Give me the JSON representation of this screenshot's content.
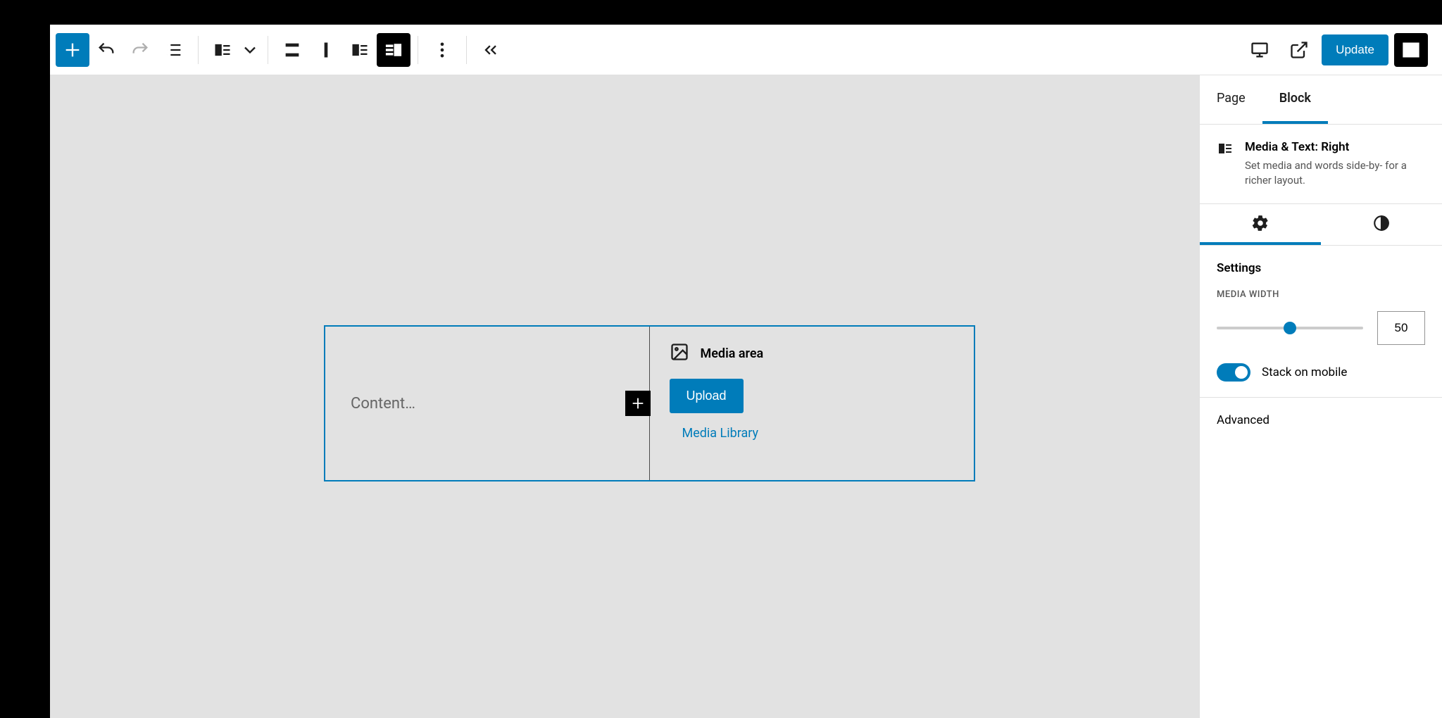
{
  "topbar": {
    "update_label": "Update"
  },
  "canvas": {
    "content_placeholder": "Content…",
    "media_title": "Media area",
    "upload_label": "Upload",
    "media_library_label": "Media Library"
  },
  "sidebar": {
    "tab_page": "Page",
    "tab_block": "Block",
    "block_title": "Media & Text: Right",
    "block_desc": "Set media and words side-by- for a richer layout.",
    "settings_heading": "Settings",
    "media_width_label": "MEDIA WIDTH",
    "media_width_value": "50",
    "stack_label": "Stack on mobile",
    "advanced_label": "Advanced"
  }
}
